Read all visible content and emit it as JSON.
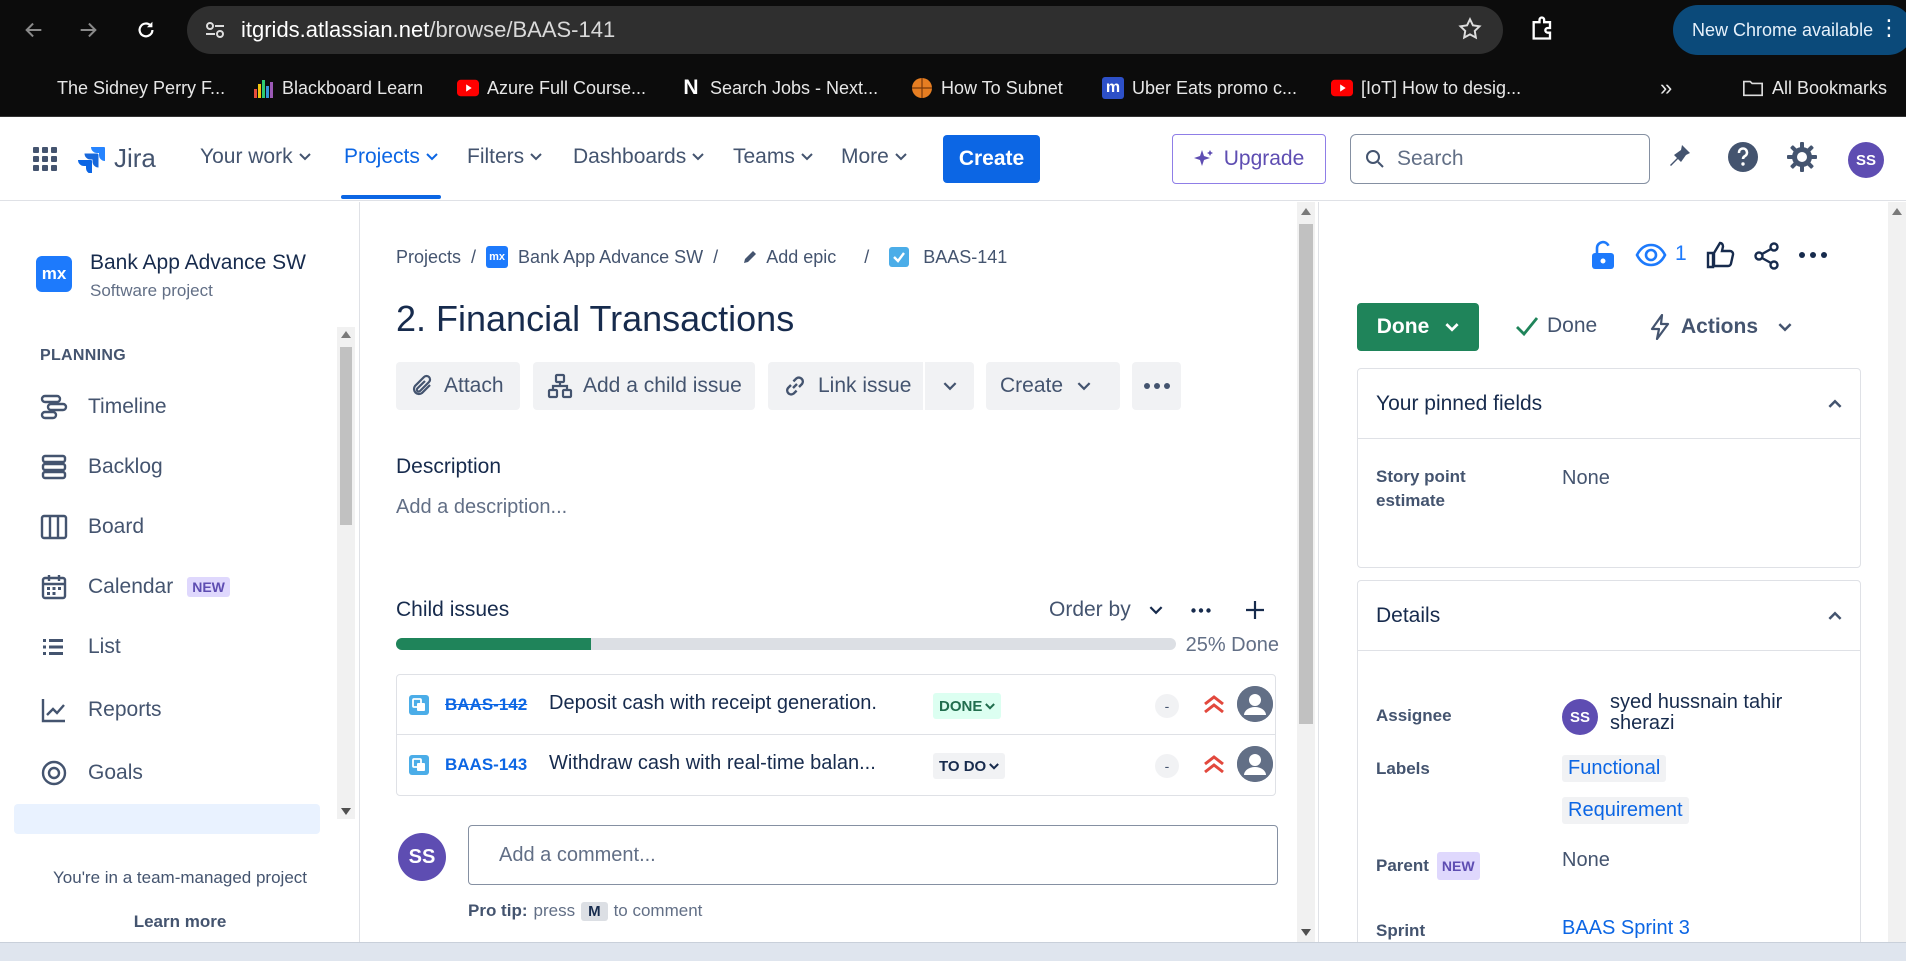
{
  "browser": {
    "url_host": "itgrids.atlassian.net",
    "url_path": "/browse/BAAS-141",
    "new_chrome_label": "New Chrome available",
    "bookmarks": [
      {
        "label": "The Sidney Perry F...",
        "icon": "blank-icon"
      },
      {
        "label": "Blackboard Learn",
        "icon": "bar-chart-icon"
      },
      {
        "label": "Azure Full Course...",
        "icon": "youtube-icon"
      },
      {
        "label": "Search Jobs - Next...",
        "icon": "n-logo-icon"
      },
      {
        "label": "How To Subnet",
        "icon": "basketball-icon"
      },
      {
        "label": "Uber Eats promo c...",
        "icon": "meetup-icon"
      },
      {
        "label": "[IoT] How to desig...",
        "icon": "youtube-icon"
      }
    ],
    "all_bookmarks_label": "All Bookmarks"
  },
  "jira_nav": {
    "logo_text": "Jira",
    "items": [
      "Your work",
      "Projects",
      "Filters",
      "Dashboards",
      "Teams",
      "More"
    ],
    "create_label": "Create",
    "upgrade_label": "Upgrade",
    "search_placeholder": "Search",
    "avatar_initials": "SS",
    "accent": "#0c66e4"
  },
  "sidebar": {
    "project_logo_text": "mx",
    "project_name": "Bank App Advance SW",
    "project_type": "Software project",
    "section_label": "PLANNING",
    "items": [
      {
        "label": "Timeline",
        "icon": "timeline-icon"
      },
      {
        "label": "Backlog",
        "icon": "backlog-icon"
      },
      {
        "label": "Board",
        "icon": "board-icon"
      },
      {
        "label": "Calendar",
        "icon": "calendar-icon",
        "badge": "NEW"
      },
      {
        "label": "List",
        "icon": "list-icon"
      },
      {
        "label": "Reports",
        "icon": "reports-icon"
      },
      {
        "label": "Goals",
        "icon": "goals-icon"
      }
    ],
    "team_managed_text": "You're in a team-managed project",
    "learn_more_label": "Learn more"
  },
  "issue": {
    "breadcrumb": {
      "projects": "Projects",
      "project": "Bank App Advance SW",
      "epic": "Add epic",
      "key": "BAAS-141"
    },
    "title": "2. Financial Transactions",
    "actions": {
      "attach": "Attach",
      "add_child": "Add a child issue",
      "link": "Link issue",
      "create": "Create"
    },
    "description_label": "Description",
    "description_placeholder": "Add a description...",
    "child_issues_label": "Child issues",
    "order_by_label": "Order by",
    "progress_fraction": 0.25,
    "progress_text": "25% Done",
    "children": [
      {
        "key": "BAAS-142",
        "summary": "Deposit cash with receipt generation.",
        "status": "DONE",
        "estimate": "-",
        "priority": "highest"
      },
      {
        "key": "BAAS-143",
        "summary": "Withdraw cash with real-time balan...",
        "status": "TO DO",
        "estimate": "-",
        "priority": "highest"
      }
    ],
    "comment_avatar": "SS",
    "comment_placeholder": "Add a comment...",
    "pro_tip_label": "Pro tip:",
    "pro_tip_press": "press",
    "pro_tip_key": "M",
    "pro_tip_suffix": "to comment"
  },
  "right_panel": {
    "watchers_count": "1",
    "status_label": "Done",
    "resolution_label": "Done",
    "actions_label": "Actions",
    "pinned": {
      "title": "Your pinned fields",
      "story_point_label": "Story point estimate",
      "story_point_value": "None"
    },
    "details": {
      "title": "Details",
      "assignee_label": "Assignee",
      "assignee_initials": "SS",
      "assignee_name": "syed hussnain tahir sherazi",
      "labels_label": "Labels",
      "labels": [
        "Functional",
        "Requirement"
      ],
      "parent_label": "Parent",
      "parent_badge": "NEW",
      "parent_value": "None",
      "sprint_label": "Sprint",
      "sprint_value": "BAAS Sprint 3"
    }
  }
}
